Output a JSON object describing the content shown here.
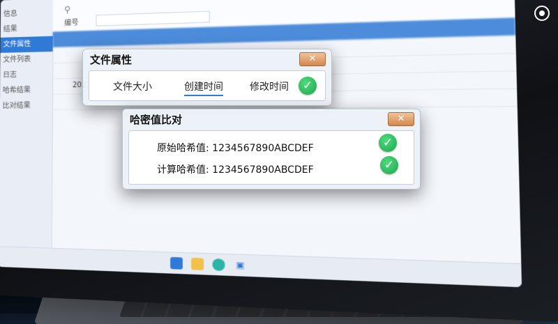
{
  "sidebar": {
    "items": [
      {
        "label": "信息",
        "active": false
      },
      {
        "label": "结果",
        "active": false
      },
      {
        "label": "文件属性",
        "active": true
      },
      {
        "label": "文件列表",
        "active": false
      },
      {
        "label": "日志",
        "active": false
      },
      {
        "label": "哈希结果",
        "active": false
      },
      {
        "label": "比对结果",
        "active": false
      }
    ]
  },
  "toolbar": {
    "filter_label": "编号"
  },
  "file_list": {
    "rows": [
      "2023"
    ]
  },
  "properties_dialog": {
    "title": "文件属性",
    "close_label": "✕",
    "tabs": [
      {
        "label": "文件大小",
        "active": false
      },
      {
        "label": "创建时间",
        "active": true
      },
      {
        "label": "修改时间",
        "active": false
      }
    ],
    "status_icon": "check-circle"
  },
  "hash_dialog": {
    "title": "哈密值比对",
    "close_label": "✕",
    "original_label": "原始哈希值:",
    "original_value": "1234567890ABCDEF",
    "computed_label": "计算哈希值:",
    "computed_value": "1234567890ABCDEF",
    "status_icon": "check-circle"
  },
  "colors": {
    "accent": "#2f7ad6",
    "success": "#22b352",
    "close_button": "#d4874c"
  }
}
